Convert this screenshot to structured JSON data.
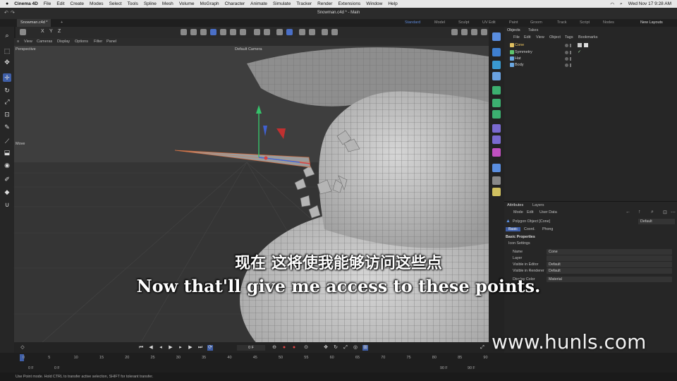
{
  "macbar": {
    "app": "Cinema 4D",
    "menus": [
      "File",
      "Edit",
      "Create",
      "Modes",
      "Select",
      "Tools",
      "Spline",
      "Mesh",
      "Volume",
      "MoGraph",
      "Character",
      "Animate",
      "Simulate",
      "Tracker",
      "Render",
      "Extensions",
      "Window",
      "Help"
    ],
    "datetime": "Wed Nov 17  9:28 AM"
  },
  "window": {
    "title": "Snowman.c4d * - Main",
    "doc_tab": "Snowman.c4d *"
  },
  "layouts": [
    "Standard",
    "Model",
    "Sculpt",
    "UV Edit",
    "Paint",
    "Groom",
    "Track",
    "Script",
    "Nodes"
  ],
  "new_layouts": "New Layouts",
  "axis_buttons": [
    "X",
    "Y",
    "Z"
  ],
  "viewport": {
    "menu": [
      "View",
      "Cameras",
      "Display",
      "Options",
      "Filter",
      "Panel"
    ],
    "label": "Perspective",
    "camera": "Default Camera",
    "tool_label": "Move"
  },
  "objects_panel": {
    "tabs": [
      "Objects",
      "Takes"
    ],
    "menu": [
      "File",
      "Edit",
      "View",
      "Object",
      "Tags",
      "Bookmarks"
    ],
    "objects": [
      {
        "name": "Cone",
        "color": "#e0c060",
        "selected": true
      },
      {
        "name": "Symmetry",
        "color": "#5dc46c",
        "selected": false
      },
      {
        "name": "Hat",
        "color": "#6ba7e0",
        "selected": false
      },
      {
        "name": "Body",
        "color": "#6ba7e0",
        "selected": false
      }
    ]
  },
  "attributes_panel": {
    "tabs": [
      "Attributes",
      "Layers"
    ],
    "menu": [
      "Mode",
      "Edit",
      "User Data"
    ],
    "object_title": "Polygon Object [Cone]",
    "preset": "Default",
    "subtabs": [
      "Basic",
      "Coord.",
      "Phong"
    ],
    "section": "Basic Properties",
    "icon_settings": "Icon Settings",
    "fields": [
      {
        "label": "Name",
        "value": "Cone"
      },
      {
        "label": "Layer",
        "value": ""
      },
      {
        "label": "Visible in Editor",
        "value": "Default"
      },
      {
        "label": "Visible in Renderer",
        "value": "Default"
      },
      {
        "label": "Display Color",
        "value": "Material"
      }
    ]
  },
  "transport": {
    "current_frame": "0 F"
  },
  "timeline": {
    "ticks": [
      "0",
      "5",
      "10",
      "15",
      "20",
      "25",
      "30",
      "35",
      "40",
      "45",
      "50",
      "55",
      "60",
      "65",
      "70",
      "75",
      "80",
      "85",
      "90"
    ],
    "start": "0 F",
    "start2": "0 F",
    "end": "90 F",
    "end2": "90 F"
  },
  "status": "Use Point mode. Hold CTRL to transfer active selection, SHIFT for tolerant transfer.",
  "subtitles": {
    "cn": "现在 这将使我能够访问这些点",
    "en": "Now that'll give me access to these points."
  },
  "watermark": "www.hunls.com"
}
